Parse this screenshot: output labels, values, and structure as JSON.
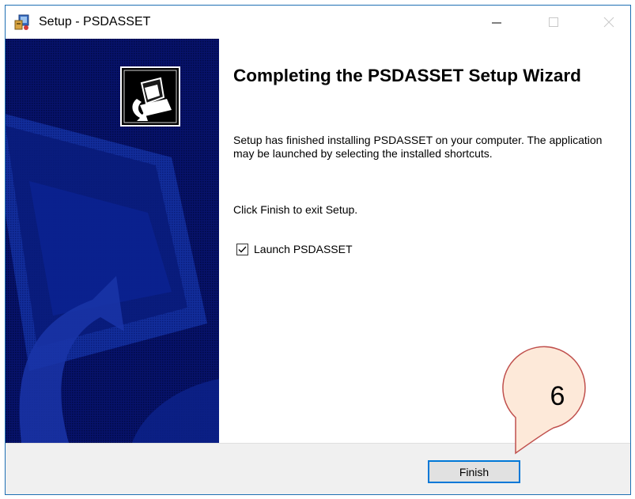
{
  "window": {
    "title": "Setup - PSDASSET",
    "controls": {
      "minimize_icon": "minimize-icon",
      "maximize_icon": "maximize-icon",
      "close_icon": "close-icon"
    }
  },
  "left_panel": {
    "background_color": "#050f5c",
    "accent_color": "#1a35a8",
    "installer_icon": "computer-install-icon"
  },
  "content": {
    "heading": "Completing the PSDASSET Setup Wizard",
    "body": "Setup has finished installing PSDASSET on your computer. The application may be launched by selecting the installed shortcuts.",
    "hint": "Click Finish to exit Setup.",
    "launch_checkbox": {
      "label": "Launch PSDASSET",
      "checked": true
    }
  },
  "footer": {
    "finish_label": "Finish"
  },
  "annotation": {
    "step_number": "6",
    "fill_color": "#fde9d9",
    "stroke_color": "#c0504d"
  }
}
